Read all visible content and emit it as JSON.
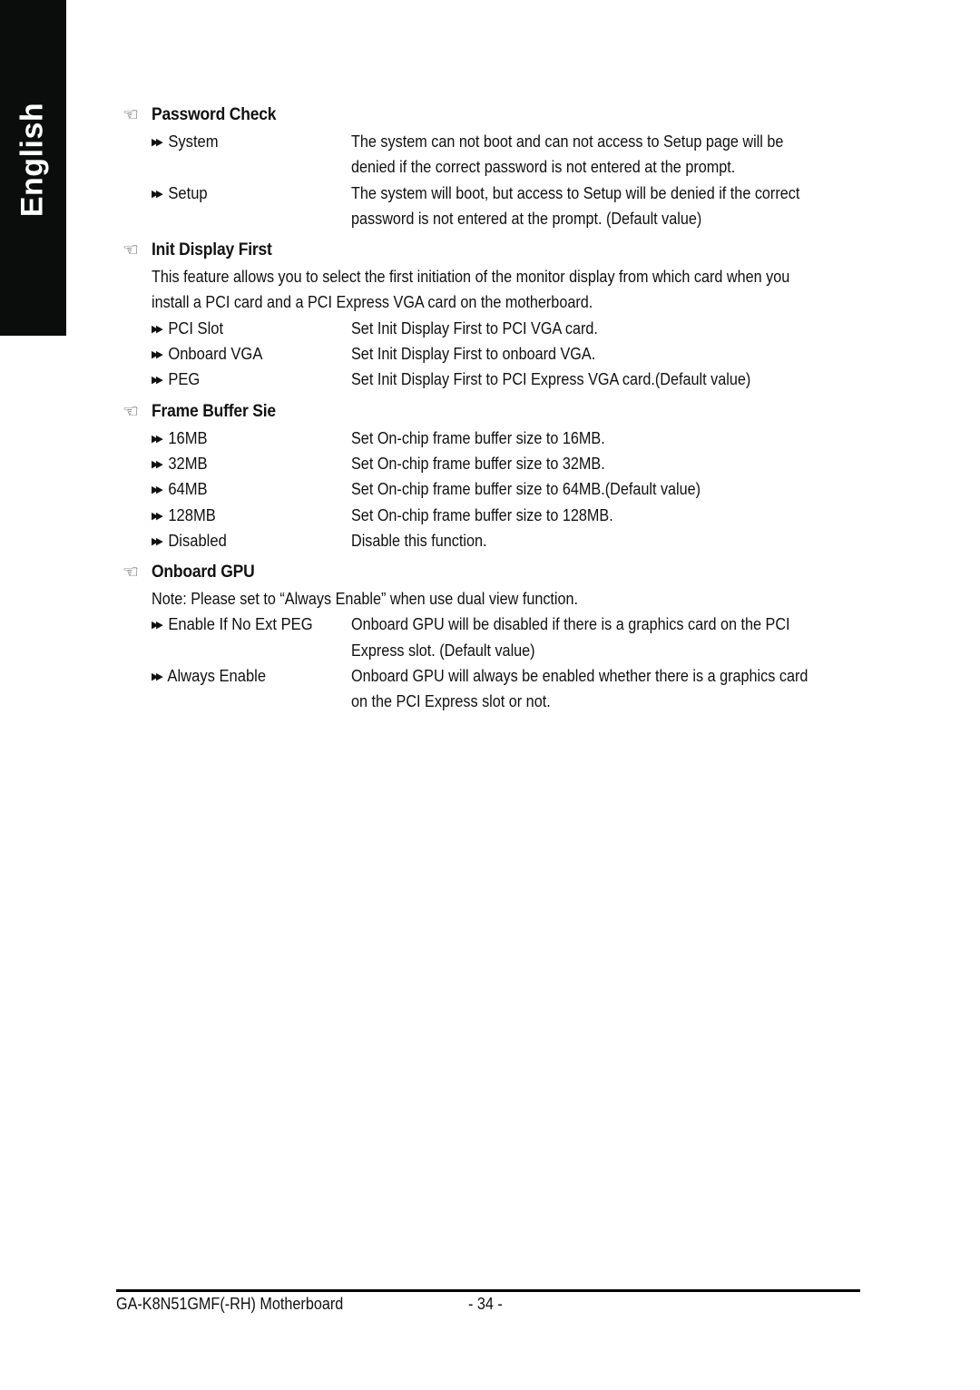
{
  "side_tab": {
    "label": "English",
    "color": "#0b0c0c"
  },
  "sections": [
    {
      "title": "Password Check",
      "options": [
        {
          "label": "System",
          "desc": [
            "The system can not boot and can not access to Setup page will be",
            "denied if the correct password is not entered at the prompt."
          ]
        },
        {
          "label": "Setup",
          "desc": [
            "The system will boot, but access to Setup will be denied if the correct",
            "password is not entered at the prompt. (Default value)"
          ]
        }
      ]
    },
    {
      "title": "Init Display First",
      "intro": [
        "This feature allows you to select the first initiation of the monitor display from which card when you",
        "install a PCI card and a PCI Express VGA card on the motherboard."
      ],
      "options": [
        {
          "label": "PCI Slot",
          "desc": [
            "Set Init Display First to PCI VGA card."
          ]
        },
        {
          "label": "Onboard VGA",
          "desc": [
            "Set Init Display First to onboard VGA."
          ]
        },
        {
          "label": "PEG",
          "desc": [
            "Set Init Display First to PCI Express VGA card.(Default value)"
          ]
        }
      ]
    },
    {
      "title": "Frame Buffer Sie",
      "options": [
        {
          "label": "16MB",
          "desc": [
            "Set On-chip frame buffer size to 16MB."
          ]
        },
        {
          "label": "32MB",
          "desc": [
            "Set On-chip frame buffer size to 32MB."
          ]
        },
        {
          "label": "64MB",
          "desc": [
            "Set On-chip frame buffer size to 64MB.(Default value)"
          ]
        },
        {
          "label": "128MB",
          "desc": [
            "Set On-chip frame buffer size to 128MB."
          ]
        },
        {
          "label": "Disabled",
          "desc": [
            "Disable this function."
          ]
        }
      ]
    },
    {
      "title": "Onboard GPU",
      "intro": [
        "Note: Please set to “Always Enable” when use dual view function."
      ],
      "options": [
        {
          "label": "Enable If No Ext PEG",
          "desc": [
            "Onboard GPU will be disabled if there is a graphics card on the PCI",
            "Express slot. (Default value)"
          ]
        },
        {
          "label": "Always Enable",
          "desc": [
            "Onboard GPU will always be enabled whether there is a graphics card",
            "on the PCI Express slot or not."
          ]
        }
      ]
    }
  ],
  "icons": {
    "section": "pointing-hand-icon",
    "option": "double-triangle-bullet-icon"
  },
  "footer": {
    "model": "GA-K8N51GMF(-RH) Motherboard",
    "page": "- 34 -"
  }
}
